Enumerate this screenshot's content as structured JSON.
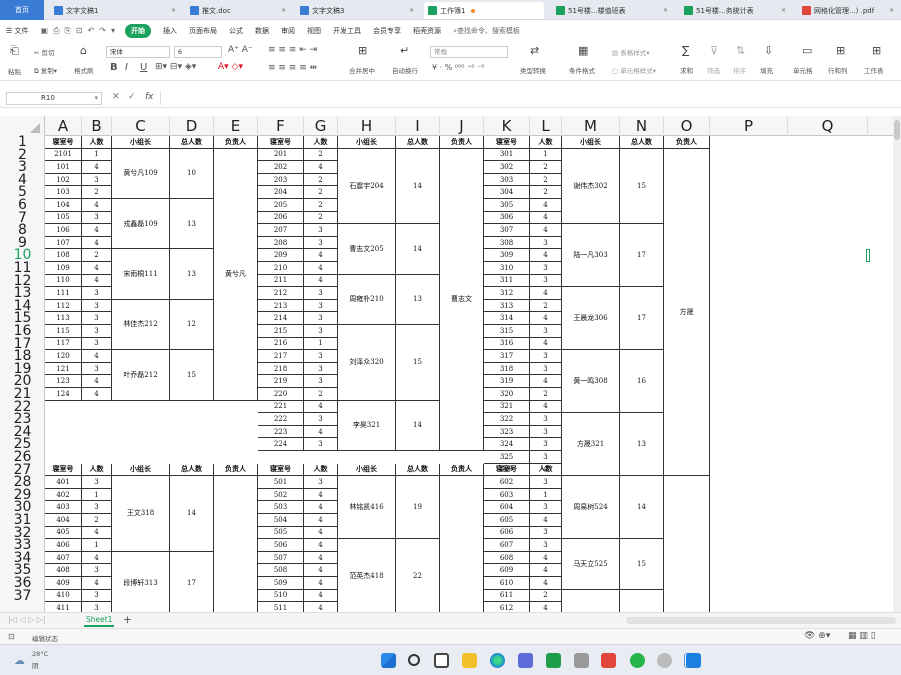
{
  "tabs": [
    {
      "label": "首页",
      "color": "#3a7bd5"
    },
    {
      "label": "文字文稿1",
      "color": "#3a7bd5"
    },
    {
      "label": "推文.doc",
      "color": "#3a7bd5"
    },
    {
      "label": "文字文稿3",
      "color": "#3a7bd5"
    },
    {
      "label": "工作簿1",
      "color": "#1aa15d"
    },
    {
      "label": "51号楼...楼值班表",
      "color": "#1aa15d"
    },
    {
      "label": "51号楼...务统计表",
      "color": "#1aa15d"
    },
    {
      "label": "网格化管理...) .pdf",
      "color": "#e0463a"
    }
  ],
  "menu": {
    "file": "文件",
    "start": "开始",
    "items": [
      "插入",
      "页面布局",
      "公式",
      "数据",
      "审阅",
      "视图",
      "开发工具",
      "会员专享",
      "稻壳资源"
    ],
    "search": "查找命令、搜索模板"
  },
  "ribbon": {
    "cut": "剪切",
    "paste": "粘贴",
    "copy": "复制",
    "format_painter": "格式刷",
    "font": "宋体",
    "size": "6",
    "merge": "合并居中",
    "wrap": "自动换行",
    "number_format": "常规",
    "convert": "类型转换",
    "cond_format": "条件格式",
    "table_style": "表格样式",
    "cell_style": "单元格样式",
    "sum": "求和",
    "filter": "筛选",
    "sort": "排序",
    "fill": "填充",
    "cell": "单元格",
    "rowcol": "行和列",
    "worksheet": "工作表"
  },
  "formula": {
    "cell_ref": "R10",
    "fx": "fx"
  },
  "columns": [
    "A",
    "B",
    "C",
    "D",
    "E",
    "F",
    "G",
    "H",
    "I",
    "J",
    "K",
    "L",
    "M",
    "N",
    "O",
    "P",
    "Q"
  ],
  "rows": [
    "1",
    "2",
    "3",
    "4",
    "5",
    "6",
    "7",
    "8",
    "9",
    "10",
    "11",
    "12",
    "13",
    "14",
    "15",
    "16",
    "17",
    "18",
    "19",
    "20",
    "21",
    "22",
    "23",
    "24",
    "25",
    "26",
    "27",
    "28",
    "29",
    "30",
    "31",
    "32",
    "33",
    "34",
    "35",
    "36",
    "37"
  ],
  "headers": {
    "room": "寝室号",
    "people": "人数",
    "leader": "小组长",
    "total": "总人数",
    "owner": "负责人"
  },
  "block1": {
    "A": [
      "2101",
      "101",
      "102",
      "103",
      "104",
      "105",
      "106",
      "107",
      "108",
      "109",
      "110",
      "111",
      "112",
      "113",
      "115",
      "117",
      "120",
      "121",
      "123",
      "124"
    ],
    "B": [
      "1",
      "4",
      "3",
      "2",
      "4",
      "3",
      "4",
      "4",
      "2",
      "4",
      "4",
      "3",
      "3",
      "3",
      "3",
      "3",
      "4",
      "3",
      "4",
      "4"
    ],
    "groups_C": [
      {
        "leader": "黄兮凡109",
        "total": "10",
        "rows": 4
      },
      {
        "leader": "戎鑫磊109",
        "total": "13",
        "rows": 4
      },
      {
        "leader": "宋雨桐111",
        "total": "13",
        "rows": 4
      },
      {
        "leader": "林佳杰212",
        "total": "12",
        "rows": 4
      },
      {
        "leader": "叶乔磊212",
        "total": "15",
        "rows": 4
      }
    ],
    "owner_E": "黄兮凡",
    "F": [
      "201",
      "202",
      "203",
      "204",
      "205",
      "206",
      "207",
      "208",
      "209",
      "210",
      "211",
      "212",
      "213",
      "214",
      "215",
      "216",
      "217",
      "218",
      "219",
      "220",
      "221",
      "222",
      "223",
      "224"
    ],
    "G": [
      "2",
      "4",
      "2",
      "2",
      "2",
      "2",
      "3",
      "3",
      "4",
      "4",
      "4",
      "3",
      "3",
      "3",
      "3",
      "1",
      "3",
      "3",
      "3",
      "2",
      "4",
      "3",
      "4",
      "3"
    ],
    "groups_H": [
      {
        "leader": "石震宇204",
        "total": "14",
        "rows": 6
      },
      {
        "leader": "曹志文205",
        "total": "14",
        "rows": 4
      },
      {
        "leader": "周雍朴210",
        "total": "13",
        "rows": 4
      },
      {
        "leader": "刘泽众320",
        "total": "15",
        "rows": 6
      },
      {
        "leader": "李昊321",
        "total": "14",
        "rows": 4
      }
    ],
    "owner_J": "曹志文",
    "K": [
      "301",
      "302",
      "303",
      "304",
      "305",
      "306",
      "307",
      "308",
      "309",
      "310",
      "311",
      "312",
      "313",
      "314",
      "315",
      "316",
      "317",
      "318",
      "319",
      "320",
      "321",
      "322",
      "323",
      "324",
      "325",
      "326"
    ],
    "L": [
      "1",
      "2",
      "2",
      "2",
      "4",
      "4",
      "4",
      "3",
      "4",
      "3",
      "3",
      "4",
      "2",
      "4",
      "3",
      "4",
      "3",
      "3",
      "4",
      "2",
      "4",
      "3",
      "3",
      "3",
      "3",
      "4"
    ],
    "groups_M": [
      {
        "leader": "谢伟杰302",
        "total": "15",
        "rows": 6
      },
      {
        "leader": "陆一凡303",
        "total": "17",
        "rows": 5
      },
      {
        "leader": "王晨龙306",
        "total": "17",
        "rows": 5
      },
      {
        "leader": "黄一鸣308",
        "total": "16",
        "rows": 5
      },
      {
        "leader": "方晟321",
        "total": "13",
        "rows": 5
      }
    ],
    "owner_O": "方晟"
  },
  "block2": {
    "A": [
      "401",
      "402",
      "403",
      "404",
      "405",
      "406",
      "407",
      "408",
      "409",
      "410",
      "411"
    ],
    "B": [
      "3",
      "1",
      "3",
      "2",
      "4",
      "1",
      "4",
      "3",
      "4",
      "3",
      "3"
    ],
    "groups_C": [
      {
        "leader": "王文318",
        "total": "14",
        "rows": 6
      },
      {
        "leader": "段博轩313",
        "total": "17",
        "rows": 5
      }
    ],
    "F": [
      "501",
      "502",
      "503",
      "504",
      "505",
      "506",
      "507",
      "508",
      "509",
      "510",
      "511"
    ],
    "G": [
      "3",
      "4",
      "4",
      "4",
      "4",
      "4",
      "4",
      "4",
      "4",
      "4",
      "4"
    ],
    "groups_H": [
      {
        "leader": "林铭凯416",
        "total": "19",
        "rows": 5
      },
      {
        "leader": "范英杰418",
        "total": "22",
        "rows": 6
      }
    ],
    "K": [
      "602",
      "603",
      "604",
      "605",
      "606",
      "607",
      "608",
      "609",
      "610",
      "611",
      "612"
    ],
    "L": [
      "3",
      "1",
      "3",
      "4",
      "3",
      "3",
      "4",
      "4",
      "4",
      "2",
      "4"
    ],
    "groups_M": [
      {
        "leader": "周易树524",
        "total": "14",
        "rows": 5
      },
      {
        "leader": "马天立525",
        "total": "15",
        "rows": 4
      },
      {
        "leader": "",
        "total": "",
        "rows": 2
      }
    ]
  },
  "sheet": {
    "name": "Sheet1",
    "add": "+"
  },
  "status": {
    "mode": "编辑状态"
  },
  "weather": {
    "temp": "28°C",
    "desc": "阴"
  }
}
